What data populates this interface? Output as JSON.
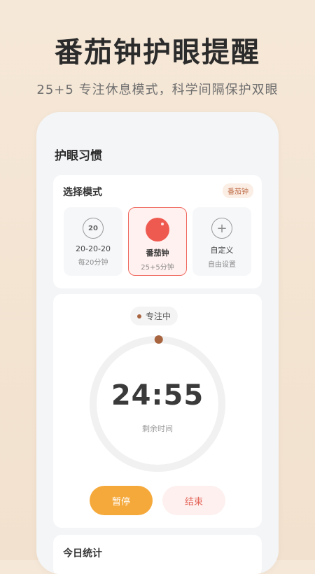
{
  "promo": {
    "headline": "番茄钟护眼提醒",
    "subline": "25+5 专注休息模式，科学间隔保护双眼"
  },
  "app": {
    "title": "护眼习惯"
  },
  "mode_selector": {
    "title": "选择模式",
    "badge": "番茄钟",
    "options": [
      {
        "icon_text": "20",
        "name": "20-20-20",
        "desc": "每20分钟",
        "active": false
      },
      {
        "icon": "tomato-icon",
        "name": "番茄钟",
        "desc": "25+5分钟",
        "active": true
      },
      {
        "icon_text": "+",
        "name": "自定义",
        "desc": "自由设置",
        "active": false
      }
    ]
  },
  "timer": {
    "status": "专注中",
    "time": "24:55",
    "label": "剩余时间",
    "progress_remaining_fraction": 0.997,
    "pause_label": "暂停",
    "end_label": "结束"
  },
  "stats": {
    "title": "今日统计"
  },
  "colors": {
    "accent_orange": "#f6a93b",
    "tomato_red": "#ef5a50",
    "progress_dot": "#a8643f",
    "end_text": "#e46458"
  }
}
